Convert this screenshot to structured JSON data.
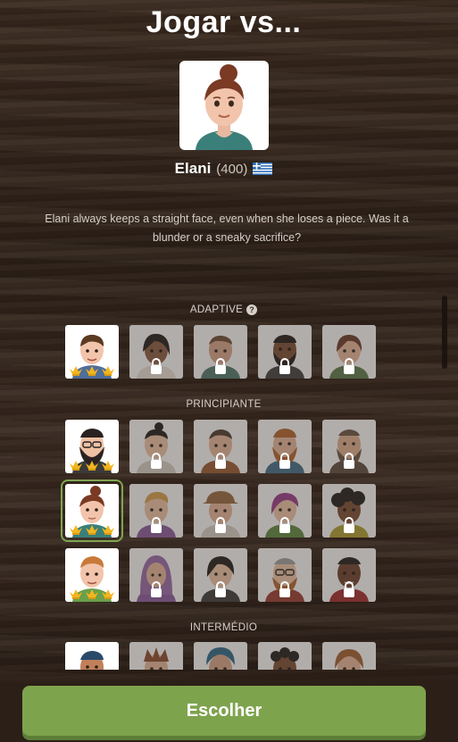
{
  "header": {
    "title": "Jogar vs..."
  },
  "selected_bot": {
    "name": "Elani",
    "rating": "(400)",
    "flag": "greece-flag-icon",
    "bio": "Elani always keeps a straight face, even when she loses a piece. Was it a blunder or a sneaky sacrifice?"
  },
  "sections": {
    "adaptive": {
      "label": "ADAPTIVE",
      "help_icon": "?"
    },
    "beginner": {
      "label": "PRINCIPIANTE"
    },
    "intermediate": {
      "label": "INTERMÉDIO"
    }
  },
  "footer": {
    "choose_label": "Escolher"
  },
  "colors": {
    "accent": "#7ea34d",
    "selected_outline": "#7fa650",
    "wood": "#3a2a1f"
  }
}
